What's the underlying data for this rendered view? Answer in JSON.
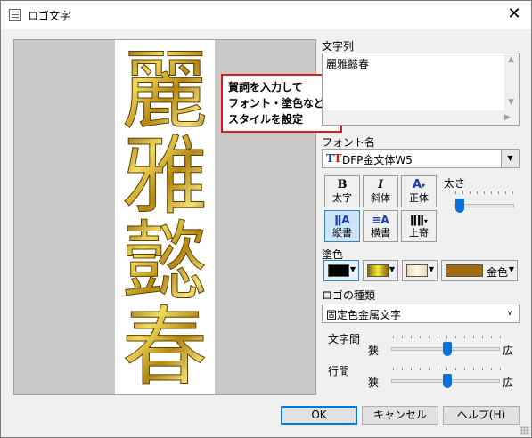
{
  "window": {
    "title": "ロゴ文字",
    "close_glyph": "✕"
  },
  "preview": {
    "logo_chars": [
      "麗",
      "雅",
      "懿",
      "春"
    ],
    "callout": [
      "賀詞を入力して",
      "フォント・塗色など",
      "スタイルを設定"
    ],
    "metal_color": "#c9a227"
  },
  "text_section": {
    "label": "文字列",
    "value": "麗雅懿春"
  },
  "font_section": {
    "label": "フォント名",
    "value": "DFP金文体W5",
    "icon": "truetype-icon"
  },
  "style_buttons": {
    "bold": {
      "icon": "B",
      "label": "太字"
    },
    "italic": {
      "icon": "I",
      "label": "斜体"
    },
    "upright": {
      "icon": "A",
      "label": "正体"
    },
    "vertical": {
      "icon": "ǁA",
      "label": "縦書"
    },
    "horizontal": {
      "icon": "≡A",
      "label": "横書"
    },
    "top_align": {
      "icon": "ǁǁ",
      "label": "上寄"
    }
  },
  "weight": {
    "label": "太さ",
    "level": 0.0
  },
  "fill": {
    "label": "塗色",
    "swatches": [
      {
        "name": "black",
        "color": "#000000"
      },
      {
        "name": "gold-gradient",
        "color": "#d9c21a"
      },
      {
        "name": "cream",
        "color": "#f8ecd6"
      }
    ],
    "preset": {
      "color": "#a06c12",
      "label": "金色"
    }
  },
  "logo_type": {
    "label": "ロゴの種類",
    "value": "固定色金属文字"
  },
  "spacing": {
    "char_label": "文字間",
    "line_label": "行間",
    "narrow": "狭",
    "wide": "広",
    "char_level": 0.5,
    "line_level": 0.5
  },
  "buttons": {
    "ok": "OK",
    "cancel": "キャンセル",
    "help": "ヘルプ(H)"
  }
}
